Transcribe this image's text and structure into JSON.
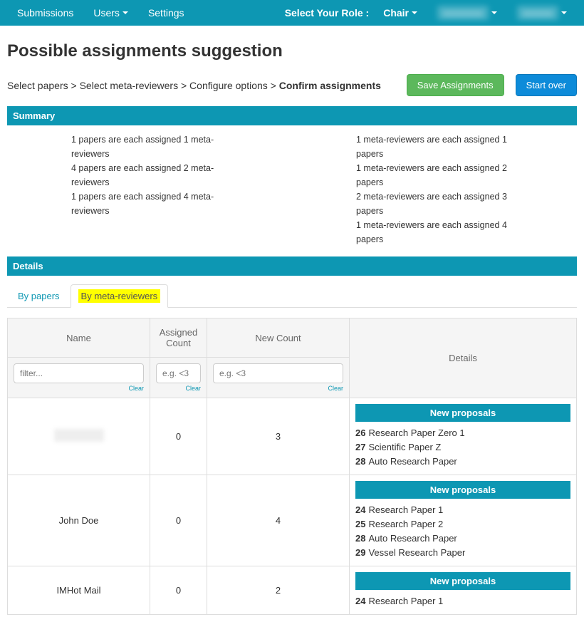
{
  "nav": {
    "items": [
      "Submissions",
      "Users",
      "Settings"
    ],
    "role_label": "Select Your Role :",
    "role_value": "Chair",
    "conf": "",
    "user": ""
  },
  "page_title": "Possible assignments suggestion",
  "crumbs": {
    "c1": "Select papers",
    "c2": "Select meta-reviewers",
    "c3": "Configure options",
    "c4": "Confirm assignments"
  },
  "buttons": {
    "save": "Save Assignments",
    "start_over": "Start over"
  },
  "sections": {
    "summary": "Summary",
    "details": "Details"
  },
  "summary_left": [
    "1 papers are each assigned 1 meta-reviewers",
    "4 papers are each assigned 2 meta-reviewers",
    "1 papers are each assigned 4 meta-reviewers"
  ],
  "summary_right": [
    "1 meta-reviewers are each assigned 1 papers",
    "1 meta-reviewers are each assigned 2 papers",
    "2 meta-reviewers are each assigned 3 papers",
    "1 meta-reviewers are each assigned 4 papers"
  ],
  "tabs": {
    "by_papers": "By papers",
    "by_reviewers": "By meta-reviewers"
  },
  "table": {
    "cols": {
      "name": "Name",
      "assigned": "Assigned Count",
      "newc": "New Count",
      "details": "Details"
    },
    "filters": {
      "name_ph": "filter...",
      "count_ph": "e.g. <3",
      "clear": "Clear"
    },
    "proposals_label": "New proposals",
    "rows": [
      {
        "name": "",
        "assigned": "0",
        "newc": "3",
        "papers": [
          {
            "n": "26",
            "t": "Research Paper Zero 1"
          },
          {
            "n": "27",
            "t": "Scientific Paper Z"
          },
          {
            "n": "28",
            "t": "Auto Research Paper"
          }
        ]
      },
      {
        "name": "John Doe",
        "assigned": "0",
        "newc": "4",
        "papers": [
          {
            "n": "24",
            "t": "Research Paper 1"
          },
          {
            "n": "25",
            "t": "Research Paper 2"
          },
          {
            "n": "28",
            "t": "Auto Research Paper"
          },
          {
            "n": "29",
            "t": "Vessel Research Paper"
          }
        ]
      },
      {
        "name": "IMHot Mail",
        "assigned": "0",
        "newc": "2",
        "papers": [
          {
            "n": "24",
            "t": "Research Paper 1"
          }
        ]
      }
    ]
  }
}
